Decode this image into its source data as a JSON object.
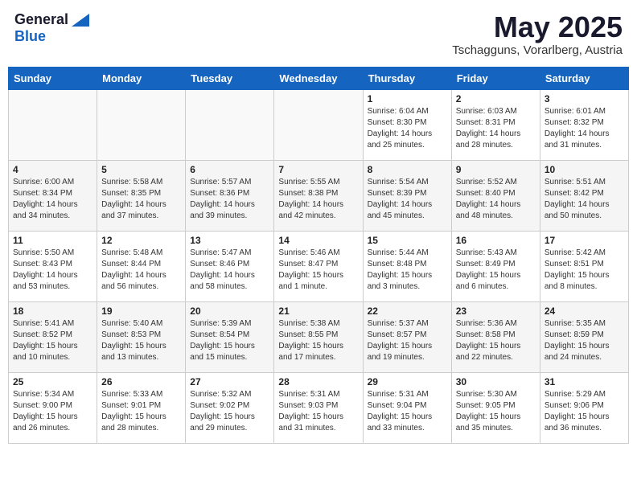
{
  "logo": {
    "general": "General",
    "blue": "Blue"
  },
  "title": "May 2025",
  "location": "Tschagguns, Vorarlberg, Austria",
  "days_of_week": [
    "Sunday",
    "Monday",
    "Tuesday",
    "Wednesday",
    "Thursday",
    "Friday",
    "Saturday"
  ],
  "weeks": [
    [
      {
        "day": "",
        "detail": ""
      },
      {
        "day": "",
        "detail": ""
      },
      {
        "day": "",
        "detail": ""
      },
      {
        "day": "",
        "detail": ""
      },
      {
        "day": "1",
        "detail": "Sunrise: 6:04 AM\nSunset: 8:30 PM\nDaylight: 14 hours\nand 25 minutes."
      },
      {
        "day": "2",
        "detail": "Sunrise: 6:03 AM\nSunset: 8:31 PM\nDaylight: 14 hours\nand 28 minutes."
      },
      {
        "day": "3",
        "detail": "Sunrise: 6:01 AM\nSunset: 8:32 PM\nDaylight: 14 hours\nand 31 minutes."
      }
    ],
    [
      {
        "day": "4",
        "detail": "Sunrise: 6:00 AM\nSunset: 8:34 PM\nDaylight: 14 hours\nand 34 minutes."
      },
      {
        "day": "5",
        "detail": "Sunrise: 5:58 AM\nSunset: 8:35 PM\nDaylight: 14 hours\nand 37 minutes."
      },
      {
        "day": "6",
        "detail": "Sunrise: 5:57 AM\nSunset: 8:36 PM\nDaylight: 14 hours\nand 39 minutes."
      },
      {
        "day": "7",
        "detail": "Sunrise: 5:55 AM\nSunset: 8:38 PM\nDaylight: 14 hours\nand 42 minutes."
      },
      {
        "day": "8",
        "detail": "Sunrise: 5:54 AM\nSunset: 8:39 PM\nDaylight: 14 hours\nand 45 minutes."
      },
      {
        "day": "9",
        "detail": "Sunrise: 5:52 AM\nSunset: 8:40 PM\nDaylight: 14 hours\nand 48 minutes."
      },
      {
        "day": "10",
        "detail": "Sunrise: 5:51 AM\nSunset: 8:42 PM\nDaylight: 14 hours\nand 50 minutes."
      }
    ],
    [
      {
        "day": "11",
        "detail": "Sunrise: 5:50 AM\nSunset: 8:43 PM\nDaylight: 14 hours\nand 53 minutes."
      },
      {
        "day": "12",
        "detail": "Sunrise: 5:48 AM\nSunset: 8:44 PM\nDaylight: 14 hours\nand 56 minutes."
      },
      {
        "day": "13",
        "detail": "Sunrise: 5:47 AM\nSunset: 8:46 PM\nDaylight: 14 hours\nand 58 minutes."
      },
      {
        "day": "14",
        "detail": "Sunrise: 5:46 AM\nSunset: 8:47 PM\nDaylight: 15 hours\nand 1 minute."
      },
      {
        "day": "15",
        "detail": "Sunrise: 5:44 AM\nSunset: 8:48 PM\nDaylight: 15 hours\nand 3 minutes."
      },
      {
        "day": "16",
        "detail": "Sunrise: 5:43 AM\nSunset: 8:49 PM\nDaylight: 15 hours\nand 6 minutes."
      },
      {
        "day": "17",
        "detail": "Sunrise: 5:42 AM\nSunset: 8:51 PM\nDaylight: 15 hours\nand 8 minutes."
      }
    ],
    [
      {
        "day": "18",
        "detail": "Sunrise: 5:41 AM\nSunset: 8:52 PM\nDaylight: 15 hours\nand 10 minutes."
      },
      {
        "day": "19",
        "detail": "Sunrise: 5:40 AM\nSunset: 8:53 PM\nDaylight: 15 hours\nand 13 minutes."
      },
      {
        "day": "20",
        "detail": "Sunrise: 5:39 AM\nSunset: 8:54 PM\nDaylight: 15 hours\nand 15 minutes."
      },
      {
        "day": "21",
        "detail": "Sunrise: 5:38 AM\nSunset: 8:55 PM\nDaylight: 15 hours\nand 17 minutes."
      },
      {
        "day": "22",
        "detail": "Sunrise: 5:37 AM\nSunset: 8:57 PM\nDaylight: 15 hours\nand 19 minutes."
      },
      {
        "day": "23",
        "detail": "Sunrise: 5:36 AM\nSunset: 8:58 PM\nDaylight: 15 hours\nand 22 minutes."
      },
      {
        "day": "24",
        "detail": "Sunrise: 5:35 AM\nSunset: 8:59 PM\nDaylight: 15 hours\nand 24 minutes."
      }
    ],
    [
      {
        "day": "25",
        "detail": "Sunrise: 5:34 AM\nSunset: 9:00 PM\nDaylight: 15 hours\nand 26 minutes."
      },
      {
        "day": "26",
        "detail": "Sunrise: 5:33 AM\nSunset: 9:01 PM\nDaylight: 15 hours\nand 28 minutes."
      },
      {
        "day": "27",
        "detail": "Sunrise: 5:32 AM\nSunset: 9:02 PM\nDaylight: 15 hours\nand 29 minutes."
      },
      {
        "day": "28",
        "detail": "Sunrise: 5:31 AM\nSunset: 9:03 PM\nDaylight: 15 hours\nand 31 minutes."
      },
      {
        "day": "29",
        "detail": "Sunrise: 5:31 AM\nSunset: 9:04 PM\nDaylight: 15 hours\nand 33 minutes."
      },
      {
        "day": "30",
        "detail": "Sunrise: 5:30 AM\nSunset: 9:05 PM\nDaylight: 15 hours\nand 35 minutes."
      },
      {
        "day": "31",
        "detail": "Sunrise: 5:29 AM\nSunset: 9:06 PM\nDaylight: 15 hours\nand 36 minutes."
      }
    ]
  ]
}
